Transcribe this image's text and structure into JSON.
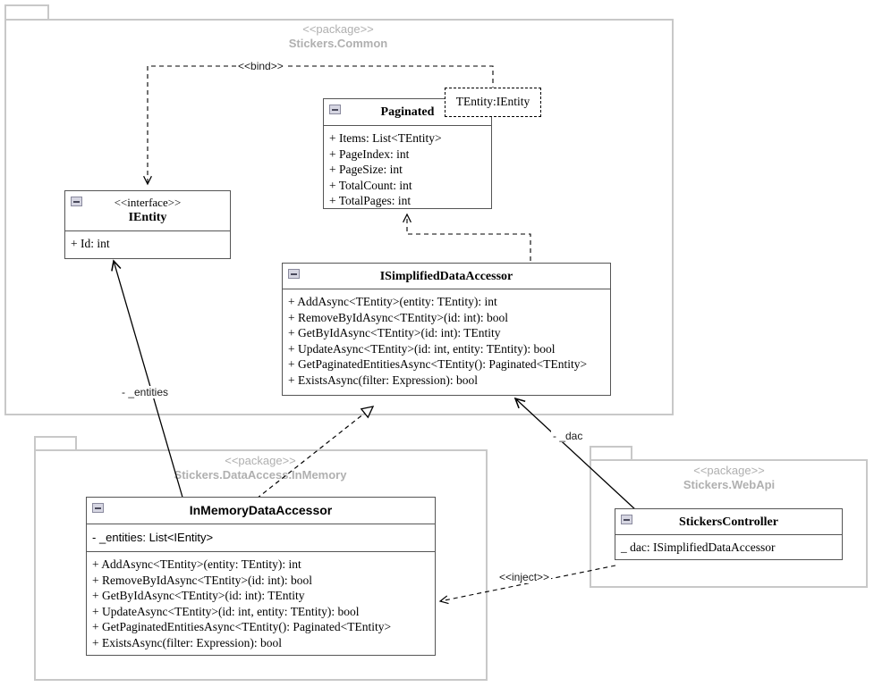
{
  "diagram": {
    "type": "uml-class-diagram",
    "title": "Stickers architecture class diagram"
  },
  "packages": [
    {
      "id": "common",
      "stereotype": "<<package>>",
      "name": "Stickers.Common"
    },
    {
      "id": "inmemory",
      "stereotype": "<<package>>",
      "name": "Stickers.DataAccess.InMemory"
    },
    {
      "id": "webapi",
      "stereotype": "<<package>>",
      "name": "Stickers.WebApi"
    }
  ],
  "classes": {
    "paginated": {
      "name": "Paginated",
      "template_parameter": "TEntity:IEntity",
      "attributes": [
        "+ Items: List<TEntity>",
        "+ PageIndex: int",
        "+ PageSize: int",
        "+ TotalCount: int",
        "+ TotalPages: int"
      ]
    },
    "ientity": {
      "stereotype": "<<interface>>",
      "name": "IEntity",
      "attributes": [
        "+ Id: int"
      ]
    },
    "isimplifieddataaccessor": {
      "name": "ISimplifiedDataAccessor",
      "operations": [
        "+ AddAsync<TEntity>(entity: TEntity): int",
        "+ RemoveByIdAsync<TEntity>(id: int): bool",
        "+ GetByIdAsync<TEntity>(id: int): TEntity",
        "+ UpdateAsync<TEntity>(id: int, entity: TEntity): bool",
        "+ GetPaginatedEntitiesAsync<TEntity(): Paginated<TEntity>",
        "+ ExistsAsync(filter: Expression): bool"
      ]
    },
    "inmemorydataaccessor": {
      "name": "InMemoryDataAccessor",
      "attributes": [
        "- _entities: List<IEntity>"
      ],
      "operations": [
        "+ AddAsync<TEntity>(entity: TEntity): int",
        "+ RemoveByIdAsync<TEntity>(id: int): bool",
        "+ GetByIdAsync<TEntity>(id: int): TEntity",
        "+ UpdateAsync<TEntity>(id: int, entity: TEntity): bool",
        "+ GetPaginatedEntitiesAsync<TEntity(): Paginated<TEntity>",
        "+ ExistsAsync(filter: Expression): bool"
      ]
    },
    "stickerscontroller": {
      "name": "StickersController",
      "attributes": [
        "_ dac: ISimplifiedDataAccessor"
      ]
    }
  },
  "relationships": [
    {
      "id": "bind",
      "label": "<<bind>>",
      "kind": "dependency-dashed"
    },
    {
      "id": "entities",
      "label": "- _entities",
      "kind": "association"
    },
    {
      "id": "dac",
      "label": "- _dac",
      "kind": "association"
    },
    {
      "id": "inject",
      "label": "<<inject>>",
      "kind": "dependency-dashed"
    },
    {
      "id": "paginated-use",
      "label": "",
      "kind": "dependency-dashed"
    },
    {
      "id": "realize",
      "label": "",
      "kind": "realization"
    }
  ],
  "colors": {
    "package_border": "#c8c8c8",
    "package_label": "#b0b0b0",
    "class_border": "#555555",
    "text": "#000000",
    "edge": "#000000",
    "icon_fill": "#d6d6e2"
  }
}
